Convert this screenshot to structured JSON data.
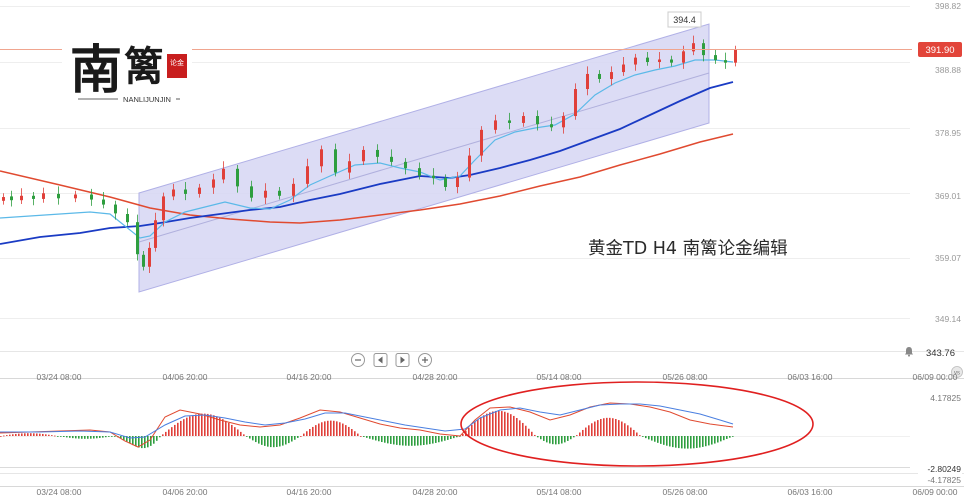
{
  "logo": {
    "char1": "南",
    "char2": "篱",
    "seal": "论金",
    "subtitle": "NANLIJUNJIN"
  },
  "watermark": "黄金TD H4 南篱论金编辑",
  "last_price_label": "391.90",
  "high_label": "394.4",
  "bottom_right_value": "343.76",
  "macd": {
    "upper_label": "4.17825",
    "lower_label": "-2.80249",
    "bottom_label": "-4.17825"
  },
  "nav_buttons": {
    "zoom_out": "⊖",
    "prev": "◂",
    "next": "▸",
    "zoom_in": "⊕"
  },
  "colors": {
    "up": "#e0403a",
    "down": "#2e9e3f",
    "ma_fast": "#5bb9e8",
    "ma_mid": "#1a3bc4",
    "ma_slow": "#e04a30",
    "channel": "#bfbfef",
    "circle": "#e02020"
  },
  "chart_data": {
    "type": "candlestick",
    "y_axis_ticks": [
      "398.82",
      "388.88",
      "378.95",
      "369.01",
      "359.07",
      "349.14"
    ],
    "time_axis_ticks": [
      "03/24 08:00",
      "04/06 20:00",
      "04/16 20:00",
      "04/28 20:00",
      "05/14 08:00",
      "05/26 08:00",
      "06/03 16:00",
      "06/09 00:00"
    ],
    "ylim": [
      343.76,
      398.82
    ],
    "last_price": 391.9,
    "high_marker": 394.4,
    "macd_ylim": [
      -2.80249,
      4.17825
    ],
    "candles": [
      {
        "t": 0,
        "o": 367.8,
        "c": 368.4
      },
      {
        "t": 8,
        "o": 368.5,
        "c": 367.9
      },
      {
        "t": 18,
        "o": 367.9,
        "c": 368.6
      },
      {
        "t": 30,
        "o": 368.6,
        "c": 368.1
      },
      {
        "t": 40,
        "o": 368.1,
        "c": 369.0
      },
      {
        "t": 55,
        "o": 368.9,
        "c": 368.2
      },
      {
        "t": 72,
        "o": 368.2,
        "c": 368.8
      },
      {
        "t": 88,
        "o": 368.8,
        "c": 368.0
      },
      {
        "t": 100,
        "o": 368.0,
        "c": 367.2
      },
      {
        "t": 112,
        "o": 367.2,
        "c": 365.8
      },
      {
        "t": 124,
        "o": 365.7,
        "c": 364.4
      },
      {
        "t": 134,
        "o": 364.4,
        "c": 359.3
      },
      {
        "t": 140,
        "o": 359.2,
        "c": 357.3
      },
      {
        "t": 146,
        "o": 357.3,
        "c": 360.3
      },
      {
        "t": 152,
        "o": 360.3,
        "c": 364.7
      },
      {
        "t": 160,
        "o": 364.7,
        "c": 368.5
      },
      {
        "t": 170,
        "o": 368.5,
        "c": 369.6
      },
      {
        "t": 182,
        "o": 369.6,
        "c": 368.9
      },
      {
        "t": 196,
        "o": 368.9,
        "c": 369.9
      },
      {
        "t": 210,
        "o": 369.9,
        "c": 371.2
      },
      {
        "t": 220,
        "o": 371.2,
        "c": 372.9
      },
      {
        "t": 234,
        "o": 372.9,
        "c": 370.1
      },
      {
        "t": 248,
        "o": 370.1,
        "c": 368.3
      },
      {
        "t": 262,
        "o": 368.3,
        "c": 369.4
      },
      {
        "t": 276,
        "o": 369.4,
        "c": 368.6
      },
      {
        "t": 290,
        "o": 368.6,
        "c": 370.5
      },
      {
        "t": 304,
        "o": 370.5,
        "c": 373.3
      },
      {
        "t": 318,
        "o": 373.3,
        "c": 376.0
      },
      {
        "t": 332,
        "o": 376.0,
        "c": 372.3
      },
      {
        "t": 346,
        "o": 372.3,
        "c": 374.1
      },
      {
        "t": 360,
        "o": 374.1,
        "c": 375.9
      },
      {
        "t": 374,
        "o": 375.9,
        "c": 374.8
      },
      {
        "t": 388,
        "o": 374.8,
        "c": 374.0
      },
      {
        "t": 402,
        "o": 374.0,
        "c": 373.0
      },
      {
        "t": 416,
        "o": 373.0,
        "c": 371.8
      },
      {
        "t": 430,
        "o": 371.8,
        "c": 371.4
      },
      {
        "t": 442,
        "o": 371.4,
        "c": 370.0
      },
      {
        "t": 454,
        "o": 370.0,
        "c": 371.5
      },
      {
        "t": 466,
        "o": 371.5,
        "c": 375.0
      },
      {
        "t": 478,
        "o": 375.0,
        "c": 379.1
      },
      {
        "t": 492,
        "o": 379.1,
        "c": 380.6
      },
      {
        "t": 506,
        "o": 380.6,
        "c": 380.2
      },
      {
        "t": 520,
        "o": 380.2,
        "c": 381.3
      },
      {
        "t": 534,
        "o": 381.3,
        "c": 380.0
      },
      {
        "t": 548,
        "o": 380.0,
        "c": 379.5
      },
      {
        "t": 560,
        "o": 379.5,
        "c": 381.3
      },
      {
        "t": 572,
        "o": 381.3,
        "c": 385.6
      },
      {
        "t": 584,
        "o": 385.6,
        "c": 388.0
      },
      {
        "t": 596,
        "o": 388.0,
        "c": 387.2
      },
      {
        "t": 608,
        "o": 387.2,
        "c": 388.3
      },
      {
        "t": 620,
        "o": 388.3,
        "c": 389.5
      },
      {
        "t": 632,
        "o": 389.5,
        "c": 390.6
      },
      {
        "t": 644,
        "o": 390.6,
        "c": 389.9
      },
      {
        "t": 656,
        "o": 389.9,
        "c": 390.3
      },
      {
        "t": 668,
        "o": 390.3,
        "c": 389.8
      },
      {
        "t": 680,
        "o": 389.8,
        "c": 391.6
      },
      {
        "t": 690,
        "o": 391.6,
        "c": 392.9
      },
      {
        "t": 700,
        "o": 392.9,
        "c": 391.0
      },
      {
        "t": 712,
        "o": 391.0,
        "c": 390.2
      },
      {
        "t": 722,
        "o": 390.2,
        "c": 389.8
      },
      {
        "t": 732,
        "o": 389.8,
        "c": 391.9
      }
    ]
  }
}
